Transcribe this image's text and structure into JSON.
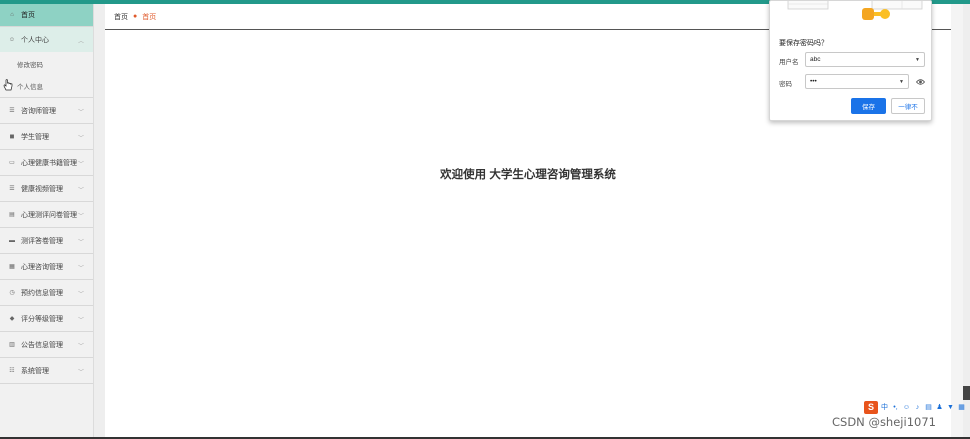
{
  "sidebar": {
    "items": [
      {
        "label": "首页",
        "icon": "home-icon",
        "glyph": "⌂",
        "state": "active"
      },
      {
        "label": "个人中心",
        "icon": "user-icon",
        "glyph": "☺",
        "state": "open"
      },
      {
        "label": "咨询师管理",
        "icon": "list-icon",
        "glyph": "☰"
      },
      {
        "label": "学生管理",
        "icon": "student-icon",
        "glyph": "◼"
      },
      {
        "label": "心理健康书籍管理",
        "icon": "book-icon",
        "glyph": "▭"
      },
      {
        "label": "健康视频管理",
        "icon": "video-list-icon",
        "glyph": "☰"
      },
      {
        "label": "心理测评问卷管理",
        "icon": "clipboard-icon",
        "glyph": "▤"
      },
      {
        "label": "测评答卷管理",
        "icon": "card-icon",
        "glyph": "▬"
      },
      {
        "label": "心理咨询管理",
        "icon": "grid-icon",
        "glyph": "▦"
      },
      {
        "label": "预约信息管理",
        "icon": "calendar-icon",
        "glyph": "◷"
      },
      {
        "label": "评分等级管理",
        "icon": "star-icon",
        "glyph": "◆"
      },
      {
        "label": "公告信息管理",
        "icon": "chart-icon",
        "glyph": "▥"
      },
      {
        "label": "系统管理",
        "icon": "settings-icon",
        "glyph": "☷"
      }
    ],
    "sub_items": [
      {
        "label": "修改密码"
      },
      {
        "label": "个人信息"
      }
    ]
  },
  "breadcrumb": {
    "home": "首页",
    "current": "首页",
    "sep_glyph": "●"
  },
  "main": {
    "welcome": "欢迎使用 大学生心理咨询管理系统"
  },
  "password_popup": {
    "title": "要保存密码吗？",
    "username_label": "用户名",
    "username_value": "abc",
    "password_label": "密码",
    "password_value": "•••",
    "save_label": "保存",
    "never_label": "一律不",
    "caret": "▼"
  },
  "ime_tray": {
    "logo": "S",
    "glyphs": [
      "中",
      "•,",
      "☺",
      "♪",
      "▤",
      "♟",
      "▼",
      "▦"
    ]
  },
  "watermark": "CSDN @sheji1071",
  "colors": {
    "accent": "#22998a",
    "active_nav": "#8ed2c4",
    "breadcrumb_active": "#e05a2b",
    "primary_button": "#1a73e8"
  }
}
